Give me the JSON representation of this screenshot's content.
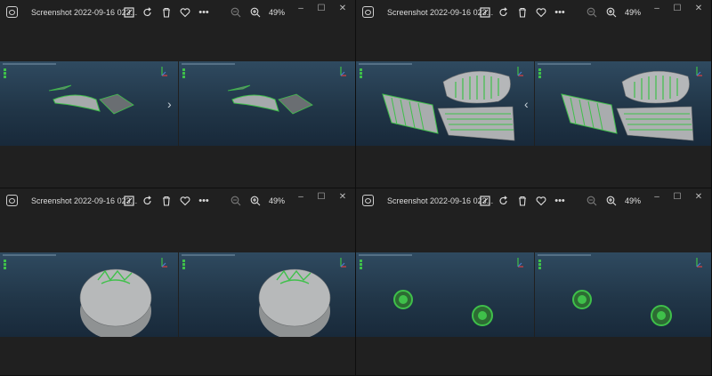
{
  "windows": [
    {
      "title": "Screenshot 2022-09-16 023...",
      "zoom": "49%",
      "model": "wing"
    },
    {
      "title": "Screenshot 2022-09-16 023...",
      "zoom": "49%",
      "model": "grille"
    },
    {
      "title": "Screenshot 2022-09-16 023...",
      "zoom": "49%",
      "model": "disk"
    },
    {
      "title": "Screenshot 2022-09-16 023...",
      "zoom": "49%",
      "model": "wheels"
    }
  ],
  "icons": {
    "edit": "edit-icon",
    "rotate": "rotate-icon",
    "delete": "delete-icon",
    "favorite": "heart-icon",
    "more": "more-icon",
    "zoom_out": "zoom-out-icon",
    "zoom_in": "zoom-in-icon"
  },
  "colors": {
    "mesh_green": "#3fc04a",
    "viewport_top": "#2f4a60"
  }
}
